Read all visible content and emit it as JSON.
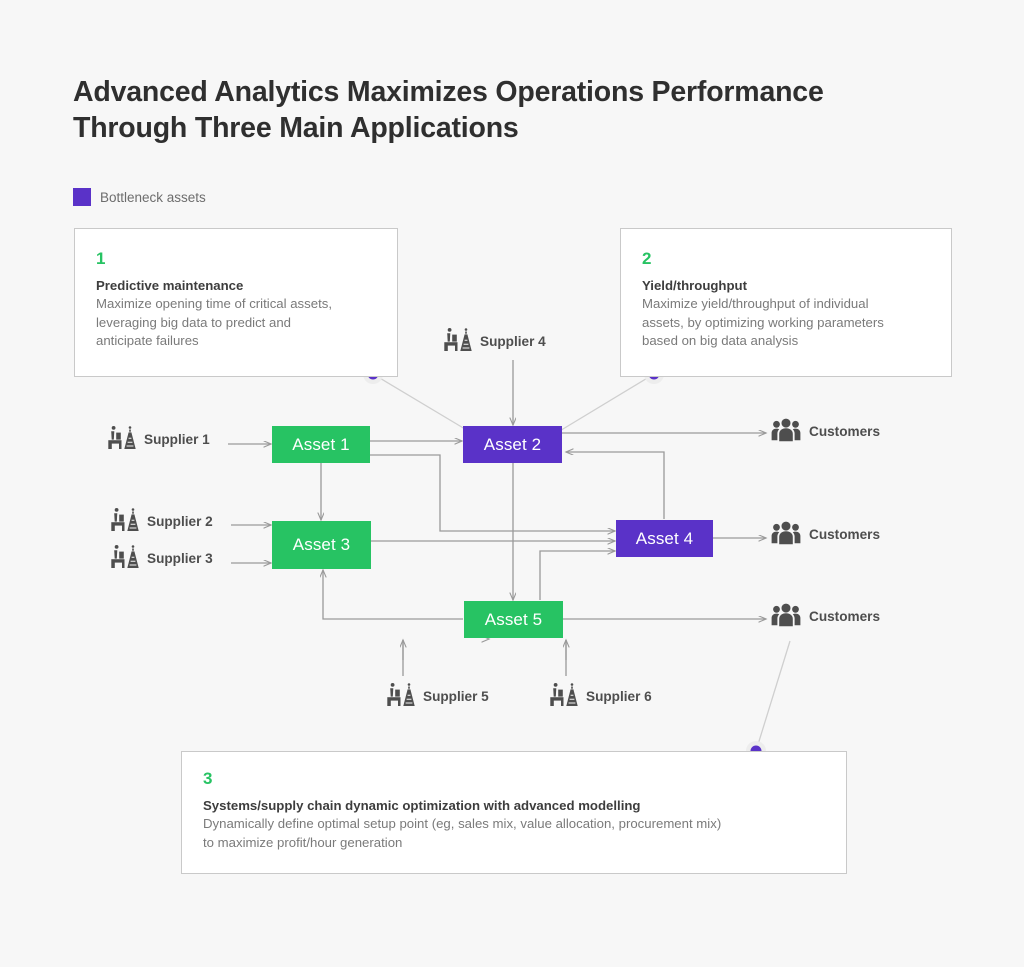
{
  "page": {
    "background": "#f7f7f7",
    "title": "Advanced Analytics Maximizes Operations Performance\nThrough Three Main Applications"
  },
  "legend": {
    "swatch_color": "#5a32c8",
    "label": "Bottleneck assets"
  },
  "colors": {
    "asset_normal": "#27c363",
    "asset_bottleneck": "#5a32c8",
    "number_green": "#27c363",
    "connector": "#9a9a9a",
    "callout_border": "#c9c9c9",
    "icon_gray": "#4e4e4e"
  },
  "callouts": [
    {
      "number": "1",
      "heading": "Predictive maintenance",
      "body": "Maximize opening time of critical assets,\nleveraging big data to predict and\nanticipate failures",
      "anchor_dot": "bottom-right"
    },
    {
      "number": "2",
      "heading": "Yield/throughput",
      "body": "Maximize yield/throughput of individual\nassets, by optimizing working parameters\nbased on big data analysis",
      "anchor_dot": "bottom-left"
    },
    {
      "number": "3",
      "heading": "Systems/supply chain dynamic optimization with advanced modelling",
      "body": "Dynamically define optimal setup point (eg, sales mix, value allocation, procurement mix)\nto maximize profit/hour generation",
      "anchor_dot": "top-right"
    }
  ],
  "assets": [
    {
      "id": "asset1",
      "label": "Asset 1",
      "type": "normal"
    },
    {
      "id": "asset2",
      "label": "Asset 2",
      "type": "bottleneck"
    },
    {
      "id": "asset3",
      "label": "Asset 3",
      "type": "normal"
    },
    {
      "id": "asset4",
      "label": "Asset 4",
      "type": "bottleneck"
    },
    {
      "id": "asset5",
      "label": "Asset 5",
      "type": "normal"
    }
  ],
  "suppliers": [
    {
      "id": "supplier1",
      "label": "Supplier 1",
      "icon": "factory-icon"
    },
    {
      "id": "supplier2",
      "label": "Supplier 2",
      "icon": "factory-icon"
    },
    {
      "id": "supplier3",
      "label": "Supplier 3",
      "icon": "factory-icon"
    },
    {
      "id": "supplier4",
      "label": "Supplier 4",
      "icon": "factory-icon"
    },
    {
      "id": "supplier5",
      "label": "Supplier 5",
      "icon": "factory-icon"
    },
    {
      "id": "supplier6",
      "label": "Supplier 6",
      "icon": "factory-icon"
    }
  ],
  "customers": [
    {
      "id": "customer1",
      "label": "Customers",
      "icon": "customers-icon"
    },
    {
      "id": "customer2",
      "label": "Customers",
      "icon": "customers-icon"
    },
    {
      "id": "customer3",
      "label": "Customers",
      "icon": "customers-icon"
    }
  ],
  "flows": [
    {
      "from": "Supplier 1",
      "to": "Asset 1"
    },
    {
      "from": "Supplier 2",
      "to": "Asset 3"
    },
    {
      "from": "Supplier 3",
      "to": "Asset 3"
    },
    {
      "from": "Supplier 4",
      "to": "Asset 2"
    },
    {
      "from": "Supplier 5",
      "to": "Asset 5"
    },
    {
      "from": "Supplier 6",
      "to": "Asset 5"
    },
    {
      "from": "Asset 1",
      "to": "Asset 2"
    },
    {
      "from": "Asset 1",
      "to": "Asset 3"
    },
    {
      "from": "Asset 1",
      "to": "Asset 4"
    },
    {
      "from": "Asset 2",
      "to": "Asset 5"
    },
    {
      "from": "Asset 2",
      "to": "Customers"
    },
    {
      "from": "Asset 3",
      "to": "Asset 4"
    },
    {
      "from": "Asset 4",
      "to": "Asset 2"
    },
    {
      "from": "Asset 4",
      "to": "Customers"
    },
    {
      "from": "Asset 5",
      "to": "Asset 3"
    },
    {
      "from": "Asset 5",
      "to": "Asset 4"
    },
    {
      "from": "Asset 5",
      "to": "Customers"
    }
  ]
}
